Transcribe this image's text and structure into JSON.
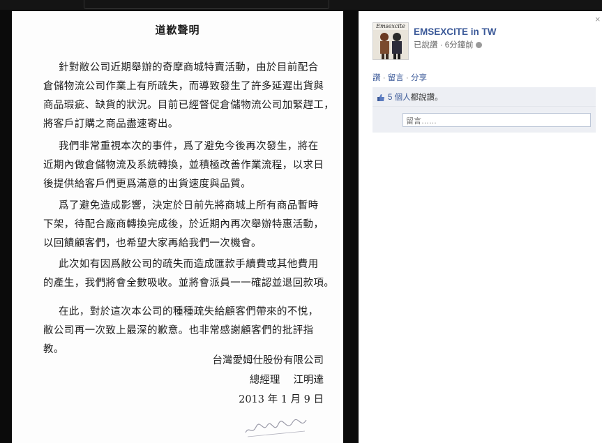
{
  "document": {
    "title": "道歉聲明",
    "paragraphs": [
      [
        "針對敝公司近期舉辦的奇摩商城特賣活動，由於目前配合",
        "倉儲物流公司作業上有所疏失，而導致發生了許多延遲出貨與",
        "商品瑕疵、缺貨的狀況。目前已經督促倉儲物流公司加緊趕工，",
        "將客戶訂購之商品盡速寄出。"
      ],
      [
        "我們非常重視本次的事件，爲了避免今後再次發生，將在",
        "近期內做倉儲物流及系統轉換，並積極改善作業流程，以求日",
        "後提供給客戶們更爲滿意的出貨速度與品質。"
      ],
      [
        "爲了避免造成影響，決定於日前先將商城上所有商品暫時",
        "下架，待配合廠商轉換完成後，於近期內再次舉辦特惠活動，",
        "以回饋顧客們，也希望大家再給我們一次機會。"
      ],
      [
        "此次如有因爲敝公司的疏失而造成匯款手續費或其他費用",
        "的產生，我們將會全數吸收。並將會派員一一確認並退回款項。"
      ],
      [
        "在此，對於這次本公司的種種疏失給顧客們帶來的不悅，",
        "敝公司再一次致上最深的歉意。也非常感謝顧客們的批評指",
        "教。"
      ]
    ],
    "company": "台灣愛姆仕股份有限公司",
    "signer": "總經理　 江明達",
    "date": "2013 年 1 月 9 日"
  },
  "post": {
    "avatar_brand": "Emsexcite",
    "page_name": "EMSEXCITE in TW",
    "status": "已說讚",
    "time": "6分鐘前",
    "actions": {
      "like": "讚",
      "comment": "留言",
      "share": "分享"
    },
    "likes_link": "5 個人",
    "likes_suffix": "都說讚。",
    "comment_placeholder": "留言……"
  },
  "colors": {
    "link": "#3b5998",
    "likes_bg": "#edeff4",
    "viewer_bg": "#0b0b0b"
  }
}
